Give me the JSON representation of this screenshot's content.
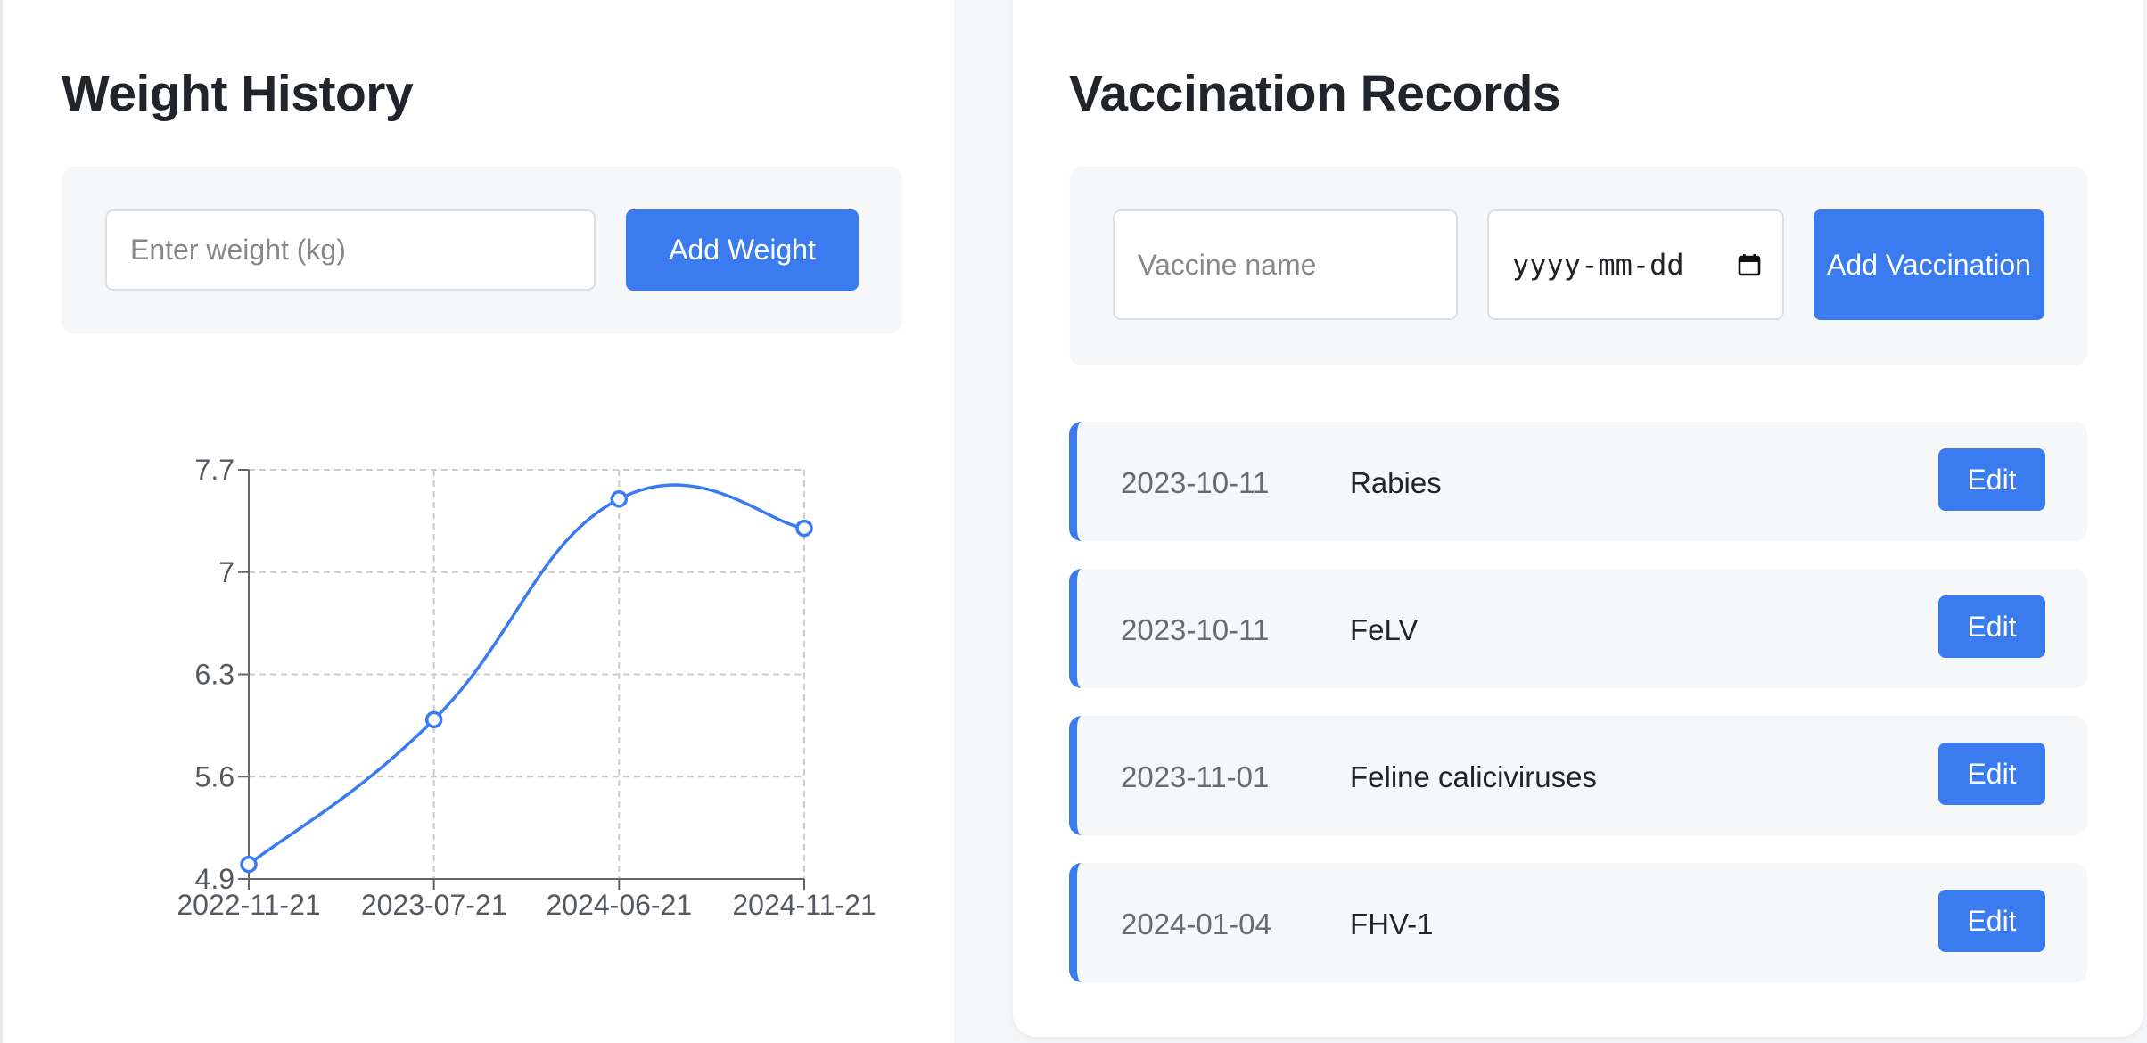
{
  "weight": {
    "title": "Weight History",
    "input_placeholder": "Enter weight (kg)",
    "add_button": "Add Weight"
  },
  "vaccinations": {
    "title": "Vaccination Records",
    "name_placeholder": "Vaccine name",
    "date_placeholder": "yyyy-mm-dd",
    "add_button": "Add Vaccination",
    "edit_label": "Edit",
    "records": [
      {
        "date": "2023-10-11",
        "name": "Rabies"
      },
      {
        "date": "2023-10-11",
        "name": "FeLV"
      },
      {
        "date": "2023-11-01",
        "name": "Feline caliciviruses"
      },
      {
        "date": "2024-01-04",
        "name": "FHV-1"
      }
    ]
  },
  "colors": {
    "accent": "#3a7bef",
    "grid": "#cccccc"
  },
  "chart_data": {
    "type": "line",
    "title": "",
    "xlabel": "",
    "ylabel": "",
    "x": [
      "2022-11-21",
      "2023-07-21",
      "2024-06-21",
      "2024-11-21"
    ],
    "series": [
      {
        "values": [
          5.0,
          5.99,
          7.5,
          7.3
        ]
      }
    ],
    "yticks": [
      "4.9",
      "5.6",
      "6.3",
      "7",
      "7.7"
    ],
    "ylim": [
      4.9,
      7.7
    ],
    "grid": true,
    "curve": "smooth"
  }
}
